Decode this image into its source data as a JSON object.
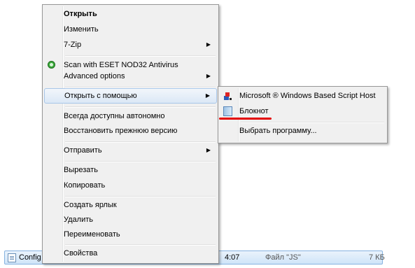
{
  "file_row": {
    "name": "Config",
    "time": "4:07",
    "type": "Файл \"JS\"",
    "size": "7 КБ"
  },
  "context_menu": {
    "items": [
      {
        "label": "Открыть",
        "bold": true
      },
      {
        "label": "Изменить"
      },
      {
        "label": "7-Zip",
        "submenu": true
      },
      {
        "label": "Scan with ESET NOD32 Antivirus",
        "icon": "eset-icon"
      },
      {
        "label": "Advanced options",
        "submenu": true
      },
      {
        "label": "Открыть с помощью",
        "submenu": true,
        "highlighted": true
      },
      {
        "label": "Всегда доступны автономно"
      },
      {
        "label": "Восстановить прежнюю версию"
      },
      {
        "label": "Отправить",
        "submenu": true
      },
      {
        "label": "Вырезать"
      },
      {
        "label": "Копировать"
      },
      {
        "label": "Создать ярлык"
      },
      {
        "label": "Удалить"
      },
      {
        "label": "Переименовать"
      },
      {
        "label": "Свойства"
      }
    ]
  },
  "open_with_submenu": {
    "items": [
      {
        "label": "Microsoft ® Windows Based Script Host",
        "icon": "script-host-icon"
      },
      {
        "label": "Блокнот",
        "icon": "notepad-icon"
      },
      {
        "label": "Выбрать программу..."
      }
    ]
  },
  "colors": {
    "highlight_border": "#a8c6e8",
    "annotation_underline": "#e30000"
  }
}
